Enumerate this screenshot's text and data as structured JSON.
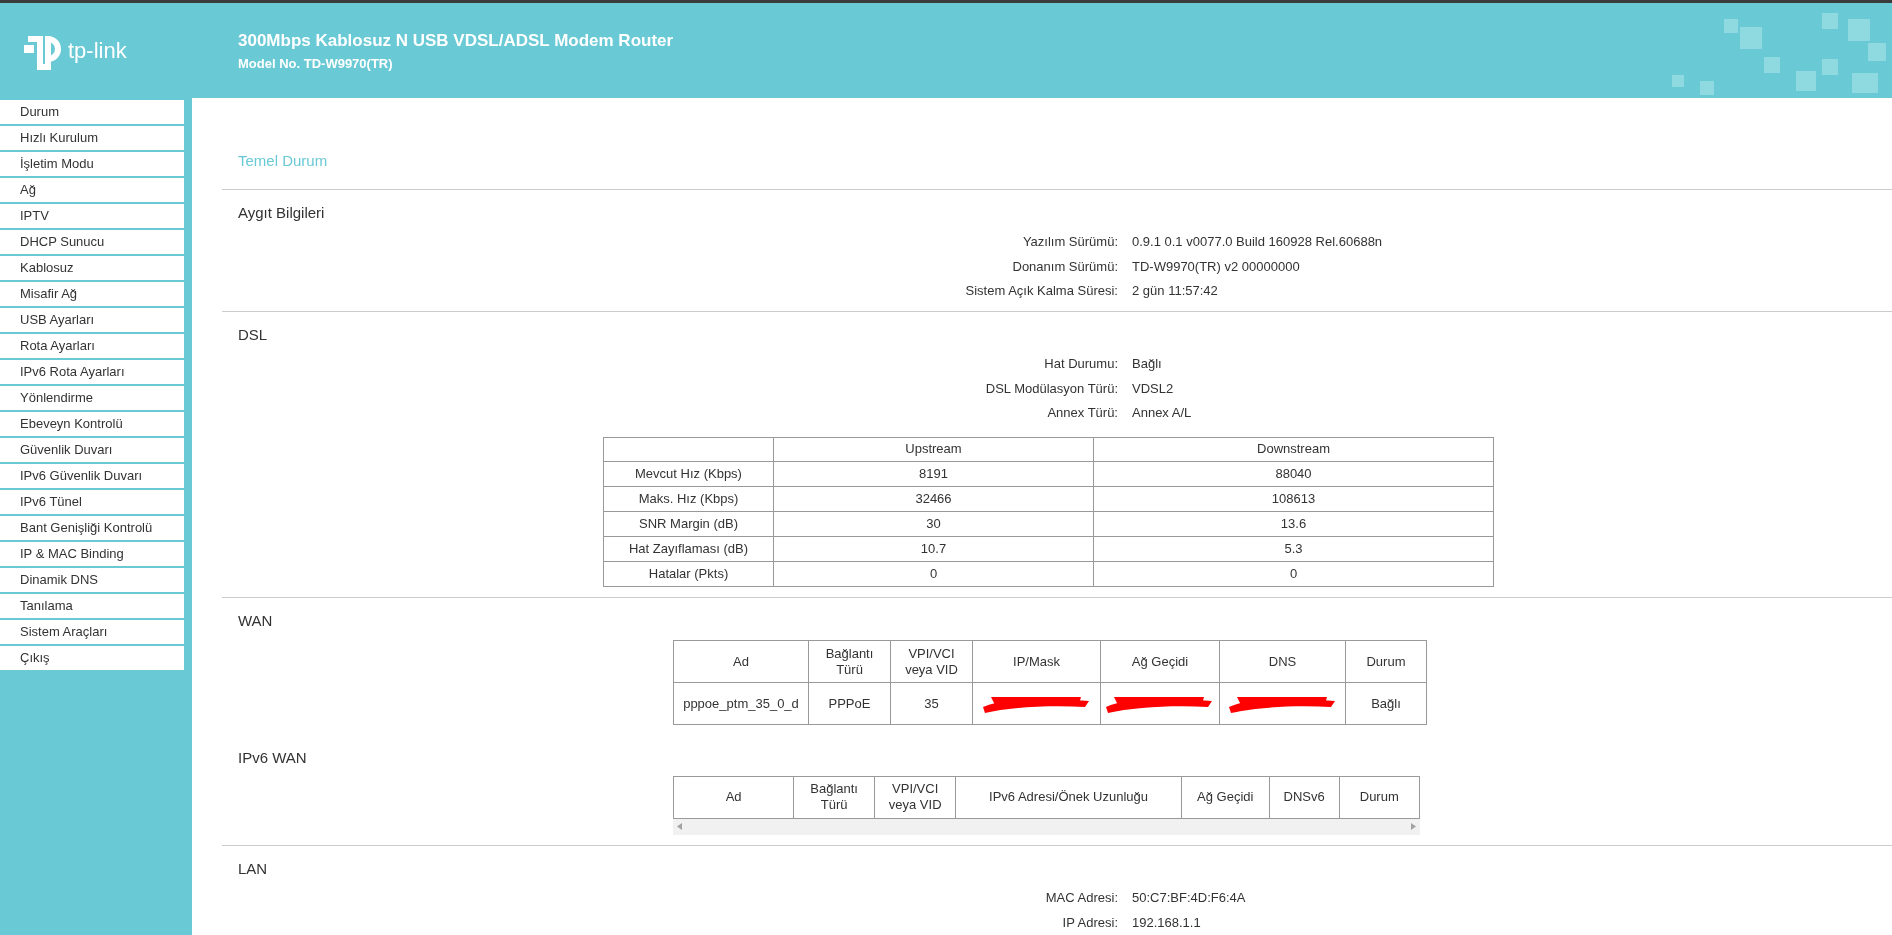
{
  "header": {
    "logo_text": "tp-link",
    "title": "300Mbps Kablosuz N USB VDSL/ADSL Modem Router",
    "model": "Model No. TD-W9970(TR)"
  },
  "sidebar": {
    "items": [
      {
        "label": "Durum",
        "selected": false
      },
      {
        "label": "Hızlı Kurulum",
        "selected": false
      },
      {
        "label": "İşletim Modu",
        "selected": false
      },
      {
        "label": "Ağ",
        "selected": false
      },
      {
        "label": "IPTV",
        "selected": false
      },
      {
        "label": "DHCP Sunucu",
        "selected": false
      },
      {
        "label": "Kablosuz",
        "selected": false
      },
      {
        "label": "Misafir Ağ",
        "selected": false
      },
      {
        "label": "USB Ayarları",
        "selected": false
      },
      {
        "label": "Rota Ayarları",
        "selected": false
      },
      {
        "label": "IPv6 Rota Ayarları",
        "selected": false
      },
      {
        "label": "Yönlendirme",
        "selected": false
      },
      {
        "label": "Ebeveyn Kontrolü",
        "selected": false
      },
      {
        "label": "Güvenlik Duvarı",
        "selected": false
      },
      {
        "label": "IPv6 Güvenlik Duvarı",
        "selected": false
      },
      {
        "label": "IPv6 Tünel",
        "selected": false
      },
      {
        "label": "Bant Genişliği Kontrolü",
        "selected": false
      },
      {
        "label": "IP & MAC Binding",
        "selected": false
      },
      {
        "label": "Dinamik DNS",
        "selected": false
      },
      {
        "label": "Tanılama",
        "selected": false
      },
      {
        "label": "Sistem Araçları",
        "selected": false
      },
      {
        "label": "Çıkış",
        "selected": false
      }
    ]
  },
  "page_title": "Temel Durum",
  "device": {
    "title": "Aygıt Bilgileri",
    "fields": [
      {
        "label": "Yazılım Sürümü:",
        "value": "0.9.1 0.1 v0077.0 Build 160928 Rel.60688n"
      },
      {
        "label": "Donanım Sürümü:",
        "value": "TD-W9970(TR) v2 00000000"
      },
      {
        "label": "Sistem Açık Kalma Süresi:",
        "value": "2 gün 11:57:42"
      }
    ]
  },
  "dsl": {
    "title": "DSL",
    "fields": [
      {
        "label": "Hat Durumu:",
        "value": "Bağlı"
      },
      {
        "label": "DSL Modülasyon Türü:",
        "value": "VDSL2"
      },
      {
        "label": "Annex Türü:",
        "value": "Annex A/L"
      }
    ],
    "table": {
      "columns": [
        "",
        "Upstream",
        "Downstream"
      ],
      "rows": [
        [
          "Mevcut Hız (Kbps)",
          "8191",
          "88040"
        ],
        [
          "Maks. Hız (Kbps)",
          "32466",
          "108613"
        ],
        [
          "SNR Margin (dB)",
          "30",
          "13.6"
        ],
        [
          "Hat Zayıflaması (dB)",
          "10.7",
          "5.3"
        ],
        [
          "Hatalar (Pkts)",
          "0",
          "0"
        ]
      ]
    }
  },
  "wan": {
    "title": "WAN",
    "columns": [
      "Ad",
      "Bağlantı Türü",
      "VPI/VCI veya VID",
      "IP/Mask",
      "Ağ Geçidi",
      "DNS",
      "Durum"
    ],
    "rows": [
      [
        {
          "kind": "text",
          "text": "pppoe_ptm_35_0_d"
        },
        {
          "kind": "text",
          "text": "PPPoE"
        },
        {
          "kind": "text",
          "text": "35"
        },
        {
          "kind": "redacted"
        },
        {
          "kind": "redacted"
        },
        {
          "kind": "redacted"
        },
        {
          "kind": "text",
          "text": "Bağlı"
        }
      ]
    ]
  },
  "ipv6_wan": {
    "title": "IPv6 WAN",
    "columns": [
      "Ad",
      "Bağlantı Türü",
      "VPI/VCI veya VID",
      "IPv6 Adresi/Önek Uzunluğu",
      "Ağ Geçidi",
      "DNSv6",
      "Durum"
    ]
  },
  "lan": {
    "title": "LAN",
    "fields": [
      {
        "label": "MAC Adresi:",
        "value": "50:C7:BF:4D:F6:4A"
      },
      {
        "label": "IP Adresi:",
        "value": "192.168.1.1"
      }
    ]
  }
}
